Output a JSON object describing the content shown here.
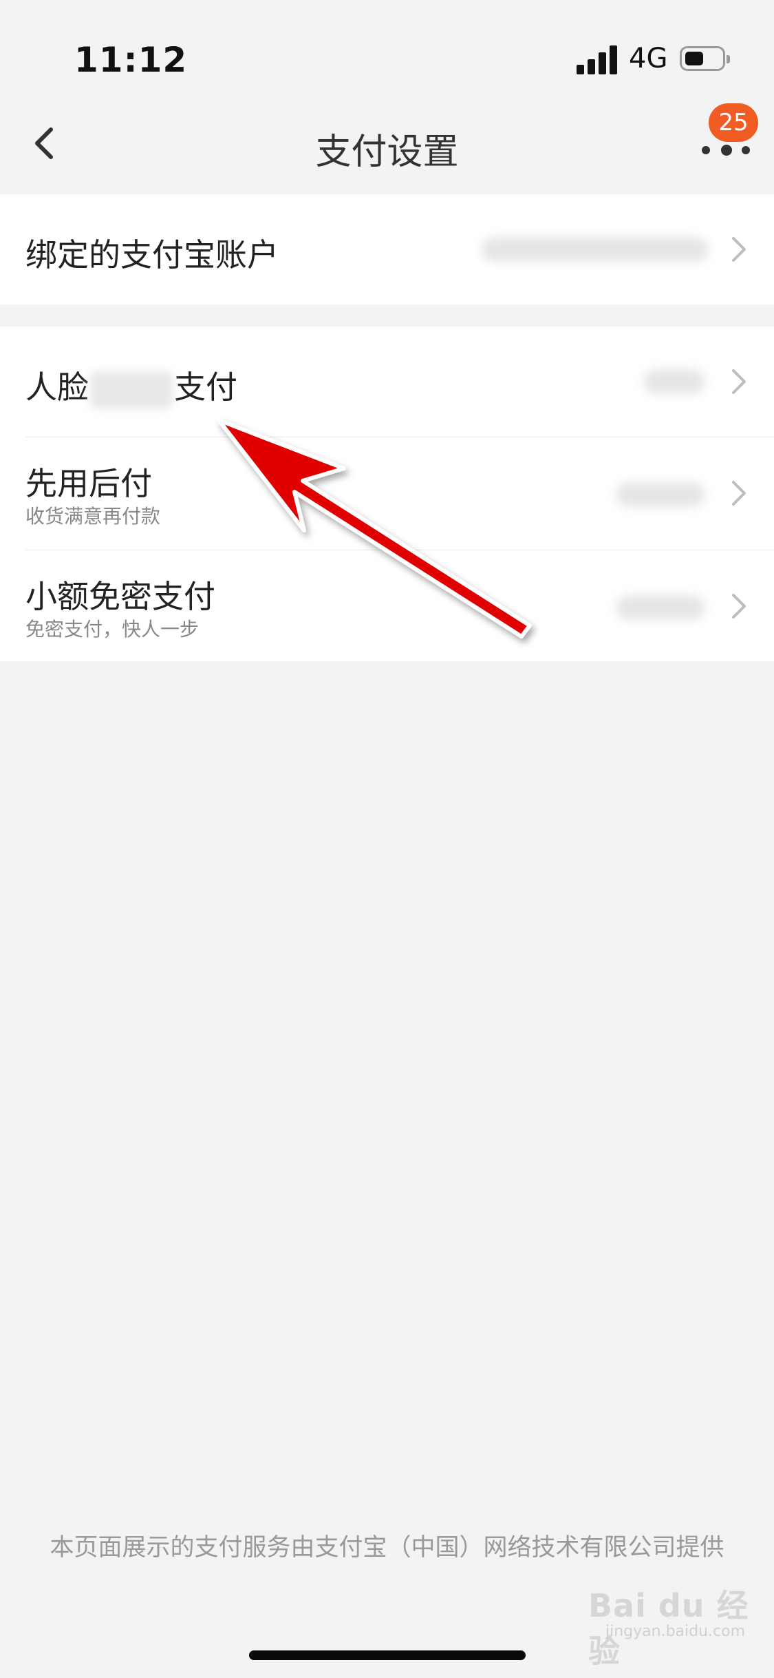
{
  "status_bar": {
    "time": "11:12",
    "network": "4G",
    "battery_icon": "battery-icon",
    "signal_icon": "signal-icon"
  },
  "nav": {
    "title": "支付设置",
    "back_icon": "chevron-left-icon",
    "more_icon": "more-dots-icon",
    "badge_count": "25"
  },
  "colors": {
    "badge": "#f15b24",
    "annotation_arrow": "#e10000",
    "background": "#f3f3f3"
  },
  "groups": {
    "account": {
      "title": "绑定的支付宝账户"
    },
    "face": {
      "title_part1": "人脸",
      "title_part2": "支付"
    },
    "later": {
      "title": "先用后付",
      "subtitle": "收货满意再付款"
    },
    "small": {
      "title": "小额免密支付",
      "subtitle": "免密支付，快人一步"
    }
  },
  "footer": {
    "note": "本页面展示的支付服务由支付宝（中国）网络技术有限公司提供"
  },
  "watermark": {
    "brand": "Bai du 经验",
    "url": "jingyan.baidu.com"
  }
}
